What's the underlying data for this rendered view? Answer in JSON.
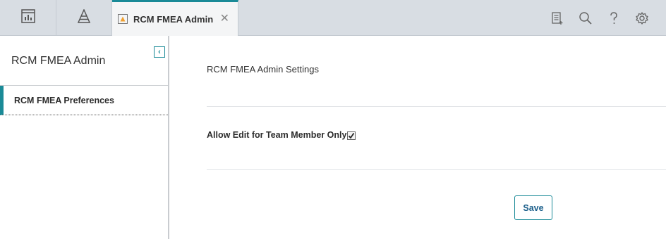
{
  "topbar": {
    "tabs": [
      {
        "icon": "dashboard-icon"
      },
      {
        "icon": "apm-pyramid-icon"
      }
    ],
    "active_tab": {
      "icon": "rcm-module-icon",
      "label": "RCM FMEA Admin",
      "close": "✕"
    },
    "actions": [
      "document-add-icon",
      "search-icon",
      "help-icon",
      "gear-icon"
    ]
  },
  "sidebar": {
    "title": "RCM FMEA Admin",
    "collapse": "‹",
    "items": [
      {
        "label": "RCM FMEA Preferences"
      }
    ]
  },
  "main": {
    "heading": "RCM FMEA Admin Settings",
    "setting_label": "Allow Edit for Team Member Only",
    "setting_checked": true,
    "save_label": "Save"
  },
  "colors": {
    "accent": "#1a8a97",
    "topbar_bg": "#d8dde3"
  }
}
